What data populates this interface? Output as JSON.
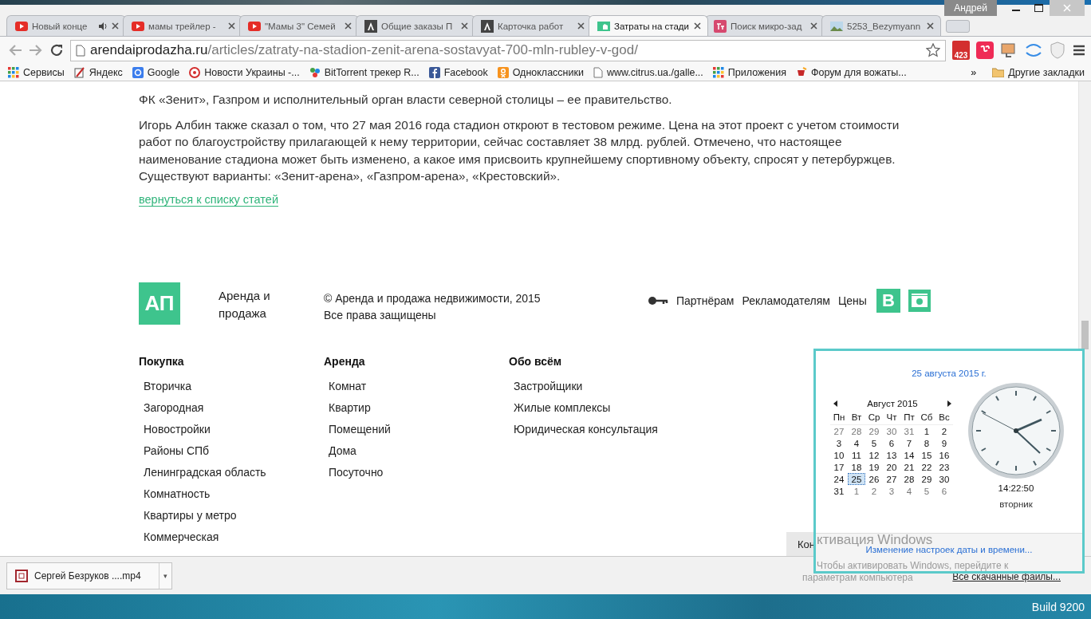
{
  "window": {
    "user": "Андрей"
  },
  "tabs": [
    {
      "title": "Новый конце",
      "kind": "youtube",
      "audio": true,
      "selected": false
    },
    {
      "title": "мамы трейлер -",
      "kind": "youtube",
      "audio": false,
      "selected": false
    },
    {
      "title": "\"Мамы 3\" Семей",
      "kind": "youtube",
      "audio": false,
      "selected": false
    },
    {
      "title": "Общие заказы П",
      "kind": "letter",
      "audio": false,
      "selected": false
    },
    {
      "title": "Карточка работ",
      "kind": "letter",
      "audio": false,
      "selected": false
    },
    {
      "title": "Затраты на стади",
      "kind": "site",
      "audio": false,
      "selected": true
    },
    {
      "title": "Поиск микро-зад",
      "kind": "pink",
      "audio": false,
      "selected": false
    },
    {
      "title": "5253_Bezymyann",
      "kind": "image",
      "audio": false,
      "selected": false
    }
  ],
  "address": {
    "domain": "arendaiprodazha.ru",
    "path": "/articles/zatraty-na-stadion-zenit-arena-sostavyat-700-mln-rubley-v-god/"
  },
  "mail_badge": "423",
  "bookmarks": [
    {
      "label": "Сервисы",
      "kind": "grid"
    },
    {
      "label": "Яндекс",
      "kind": "pencil"
    },
    {
      "label": "Google",
      "kind": "google"
    },
    {
      "label": "Новости Украины -...",
      "kind": "ring"
    },
    {
      "label": "BitTorrent трекер R...",
      "kind": "torrent"
    },
    {
      "label": "Facebook",
      "kind": "facebook"
    },
    {
      "label": "Одноклассники",
      "kind": "ok"
    },
    {
      "label": "www.citrus.ua./galle...",
      "kind": "page"
    },
    {
      "label": "Приложения",
      "kind": "grid"
    },
    {
      "label": "Форум для вожаты...",
      "kind": "cup"
    }
  ],
  "bookmarks_more": "»",
  "other_bookmarks": "Другие закладки",
  "article": {
    "paragraphs": [
      "ФК «Зенит», Газпром и исполнительный орган власти северной столицы – ее правительство.",
      "Игорь Албин также сказал о том, что 27 мая 2016 года стадион откроют в тестовом режиме. Цена на этот проект с учетом стоимости работ по благоустройству прилагающей к нему территории, сейчас составляет 38 млрд. рублей. Отмечено, что настоящее наименование стадиона может быть изменено, а какое имя присвоить крупнейшему спортивному объекту, спросят у петербуржцев. Существуют варианты: «Зенит-арена», «Газпром-арена», «Крестовский»."
    ],
    "back_link": "вернуться к списку статей"
  },
  "footer": {
    "logo": "АП",
    "brand": "Аренда и продажа",
    "copyright": "© Аренда и продажа недвижимости, 2015",
    "rights": "Все права защищены",
    "links": [
      "Партнёрам",
      "Рекламодателям",
      "Цены"
    ],
    "social_letter": "B",
    "columns": [
      {
        "heading": "Покупка",
        "items": [
          "Вторичка",
          "Загородная",
          "Новостройки",
          "Районы СПб",
          "Ленинградская область",
          "Комнатность",
          "Квартиры у метро",
          "Коммерческая"
        ]
      },
      {
        "heading": "Аренда",
        "items": [
          "Комнат",
          "Квартир",
          "Помещений",
          "Дома",
          "Посуточно"
        ]
      },
      {
        "heading": "Обо всём",
        "items": [
          "Застройщики",
          "Жилые комплексы",
          "Юридическая консультация"
        ]
      }
    ]
  },
  "downloads": {
    "file": "Сергей Безруков ....mp4",
    "caret": "▾",
    "all": "Все скачанные файлы..."
  },
  "taskbar": {
    "build": "Build 9200"
  },
  "clock_popup": {
    "date": "25 августа 2015 г.",
    "month": "Август 2015",
    "weekdays": [
      "Пн",
      "Вт",
      "Ср",
      "Чт",
      "Пт",
      "Сб",
      "Вс"
    ],
    "weeks": [
      [
        {
          "day": "27",
          "muted": true,
          "selected": false
        },
        {
          "day": "28",
          "muted": true,
          "selected": false
        },
        {
          "day": "29",
          "muted": true,
          "selected": false
        },
        {
          "day": "30",
          "muted": true,
          "selected": false
        },
        {
          "day": "31",
          "muted": true,
          "selected": false
        },
        {
          "day": "1",
          "muted": false,
          "selected": false
        },
        {
          "day": "2",
          "muted": false,
          "selected": false
        }
      ],
      [
        {
          "day": "3",
          "muted": false,
          "selected": false
        },
        {
          "day": "4",
          "muted": false,
          "selected": false
        },
        {
          "day": "5",
          "muted": false,
          "selected": false
        },
        {
          "day": "6",
          "muted": false,
          "selected": false
        },
        {
          "day": "7",
          "muted": false,
          "selected": false
        },
        {
          "day": "8",
          "muted": false,
          "selected": false
        },
        {
          "day": "9",
          "muted": false,
          "selected": false
        }
      ],
      [
        {
          "day": "10",
          "muted": false,
          "selected": false
        },
        {
          "day": "11",
          "muted": false,
          "selected": false
        },
        {
          "day": "12",
          "muted": false,
          "selected": false
        },
        {
          "day": "13",
          "muted": false,
          "selected": false
        },
        {
          "day": "14",
          "muted": false,
          "selected": false
        },
        {
          "day": "15",
          "muted": false,
          "selected": false
        },
        {
          "day": "16",
          "muted": false,
          "selected": false
        }
      ],
      [
        {
          "day": "17",
          "muted": false,
          "selected": false
        },
        {
          "day": "18",
          "muted": false,
          "selected": false
        },
        {
          "day": "19",
          "muted": false,
          "selected": false
        },
        {
          "day": "20",
          "muted": false,
          "selected": false
        },
        {
          "day": "21",
          "muted": false,
          "selected": false
        },
        {
          "day": "22",
          "muted": false,
          "selected": false
        },
        {
          "day": "23",
          "muted": false,
          "selected": false
        }
      ],
      [
        {
          "day": "24",
          "muted": false,
          "selected": false
        },
        {
          "day": "25",
          "muted": false,
          "selected": true
        },
        {
          "day": "26",
          "muted": false,
          "selected": false
        },
        {
          "day": "27",
          "muted": false,
          "selected": false
        },
        {
          "day": "28",
          "muted": false,
          "selected": false
        },
        {
          "day": "29",
          "muted": false,
          "selected": false
        },
        {
          "day": "30",
          "muted": false,
          "selected": false
        }
      ],
      [
        {
          "day": "31",
          "muted": false,
          "selected": false
        },
        {
          "day": "1",
          "muted": true,
          "selected": false
        },
        {
          "day": "2",
          "muted": true,
          "selected": false
        },
        {
          "day": "3",
          "muted": true,
          "selected": false
        },
        {
          "day": "4",
          "muted": true,
          "selected": false
        },
        {
          "day": "5",
          "muted": true,
          "selected": false
        },
        {
          "day": "6",
          "muted": true,
          "selected": false
        }
      ]
    ],
    "time": "14:22:50",
    "weekday": "вторник",
    "settings_link": "Изменение настроек даты и времени..."
  },
  "hidden_tip": "Кон",
  "activation": {
    "title": "ктивация Windows",
    "lines": [
      "Чтобы активировать Windows, перейдите к",
      "параметрам компьютера"
    ]
  }
}
